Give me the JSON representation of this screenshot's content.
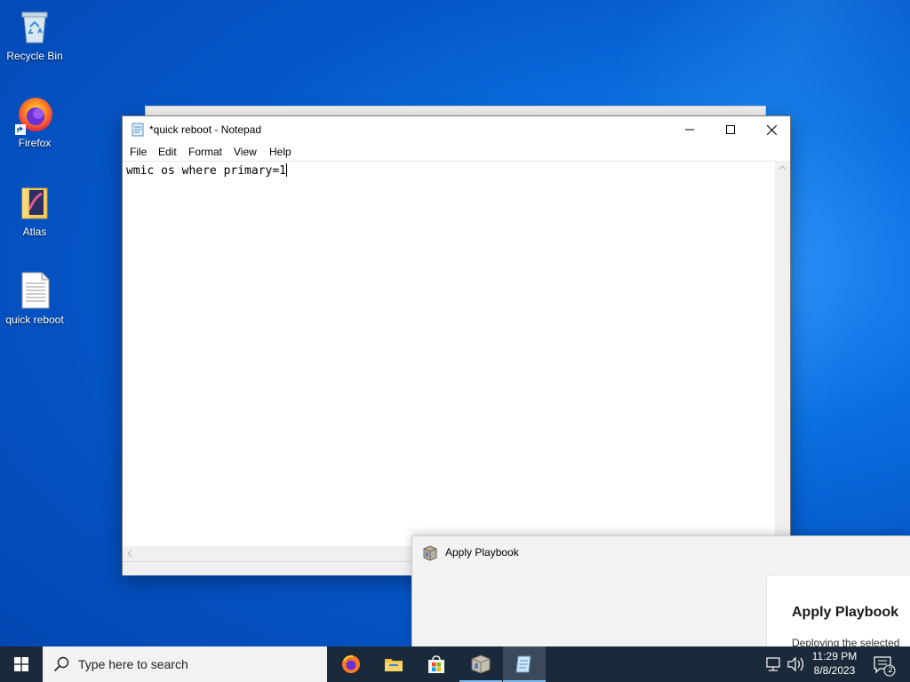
{
  "desktop": {
    "icons": [
      {
        "label": "Recycle Bin"
      },
      {
        "label": "Firefox"
      },
      {
        "label": "Atlas"
      },
      {
        "label": "quick reboot"
      }
    ]
  },
  "notepad": {
    "title": "*quick reboot - Notepad",
    "menu": [
      "File",
      "Edit",
      "Format",
      "View",
      "Help"
    ],
    "content": "wmic os where primary=1"
  },
  "playbook_window": {
    "title": "Apply Playbook",
    "heading": "Apply Playbook",
    "text": "Deploying the selected"
  },
  "taskbar": {
    "search_placeholder": "Type here to search",
    "apps": [
      "firefox-icon",
      "file-explorer-icon",
      "store-icon",
      "playbook-app-icon",
      "notepad-icon"
    ],
    "clock": {
      "time": "11:29 PM",
      "date": "8/8/2023"
    },
    "notification_count": "2"
  },
  "colors": {
    "desktop_blue": "#0a6fe0",
    "taskbar": "#1b2a3a",
    "active_underline": "#7ab8f0"
  }
}
